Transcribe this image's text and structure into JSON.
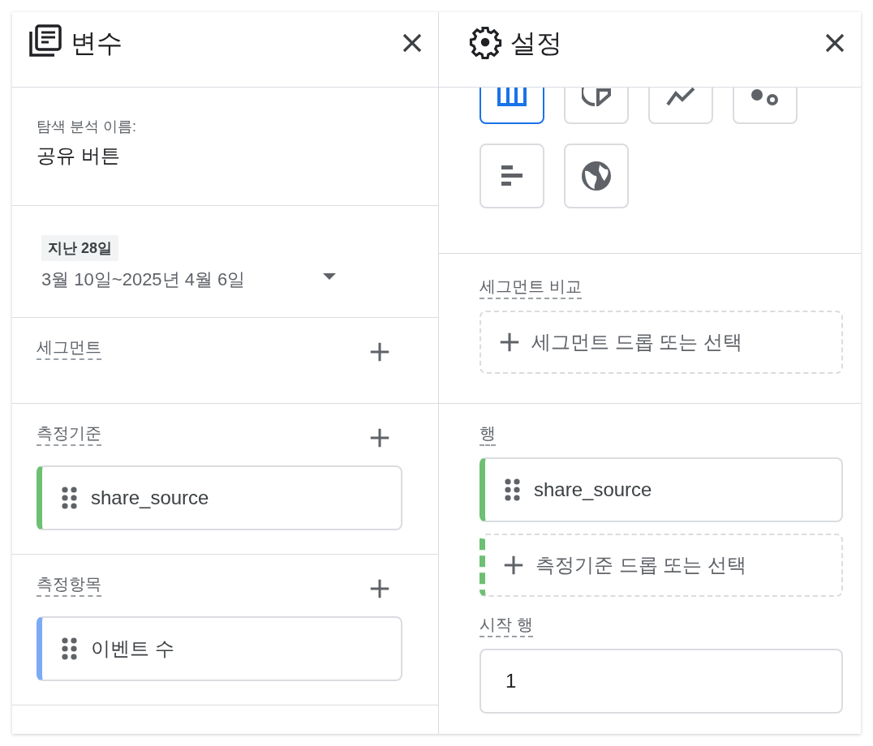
{
  "variables_panel": {
    "title": "변수",
    "exploration_name": {
      "label": "탐색 분석 이름:",
      "value": "공유 버튼"
    },
    "date_range": {
      "preset": "지난 28일",
      "range": "3월 10일~2025년 4월 6일"
    },
    "sections": [
      {
        "title": "세그먼트"
      },
      {
        "title": "측정기준",
        "items": [
          {
            "name": "share_source",
            "color": "#6dbf73"
          }
        ]
      },
      {
        "title": "측정항목",
        "items": [
          {
            "name": "이벤트 수",
            "color": "#7baaf7"
          }
        ]
      }
    ]
  },
  "settings_panel": {
    "title": "설정",
    "viz_types": [
      {
        "kind": "table",
        "selected": true
      },
      {
        "kind": "donut",
        "selected": false
      },
      {
        "kind": "line",
        "selected": false
      },
      {
        "kind": "scatter",
        "selected": false
      },
      {
        "kind": "bar",
        "selected": false
      },
      {
        "kind": "geo",
        "selected": false
      }
    ],
    "segment_comparison": {
      "label": "세그먼트 비교",
      "drop_zone": "세그먼트 드롭 또는 선택"
    },
    "rows": {
      "label": "행",
      "items": [
        {
          "name": "share_source",
          "color": "#6dbf73"
        }
      ],
      "drop_zone": "측정기준 드롭 또는 선택"
    },
    "start_row": {
      "label": "시작 행",
      "value": "1"
    }
  }
}
